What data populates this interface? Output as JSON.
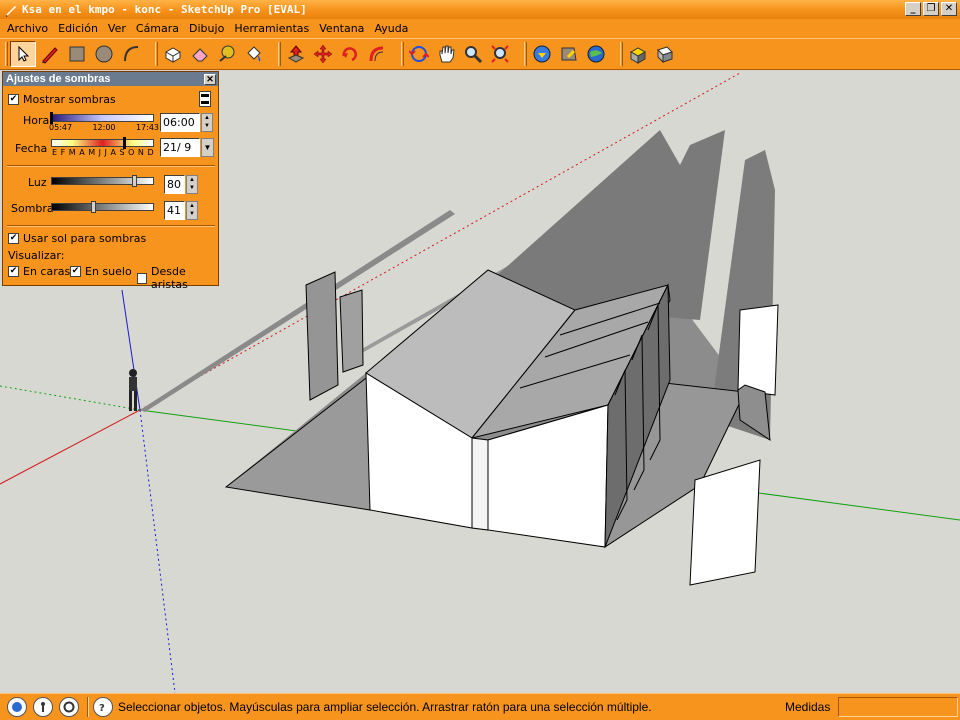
{
  "window": {
    "title": "Ksa en el kmpo - konc - SketchUp Pro [EVAL]",
    "controls": [
      "_",
      "❐",
      "✕"
    ]
  },
  "menu": [
    "Archivo",
    "Edición",
    "Ver",
    "Cámara",
    "Dibujo",
    "Herramientas",
    "Ventana",
    "Ayuda"
  ],
  "toolbar": {
    "tools": [
      "select-icon",
      "pencil-icon",
      "rectangle-icon",
      "circle-icon",
      "arc-icon",
      "make-component-icon",
      "eraser-icon",
      "tape-measure-icon",
      "paint-bucket-icon",
      "push-pull-icon",
      "move-icon",
      "rotate-icon",
      "follow-me-icon",
      "orbit-icon",
      "pan-icon",
      "zoom-icon",
      "zoom-extents-icon",
      "get-models-icon",
      "share-model-icon",
      "google-earth-icon",
      "components-icon",
      "3d-warehouse-icon"
    ]
  },
  "shadow_panel": {
    "title": "Ajustes de sombras",
    "show_shadows_label": "Mostrar sombras",
    "show_shadows_checked": true,
    "hora_label": "Hora",
    "hora_ticks": [
      "05:47",
      "12:00",
      "17:43"
    ],
    "hora_value": "06:00",
    "fecha_label": "Fecha",
    "fecha_ticks": "E F M A M J J A S O N D",
    "fecha_value": "21/ 9",
    "luz_label": "Luz",
    "luz_value": "80",
    "luz_level": 0.8,
    "sombra_label": "Sombra",
    "sombra_value": "41",
    "sombra_level": 0.41,
    "use_sun_label": "Usar sol para sombras",
    "use_sun_checked": true,
    "visualizar_label": "Visualizar:",
    "en_caras_label": "En caras",
    "en_caras_checked": true,
    "en_suelo_label": "En suelo",
    "en_suelo_checked": true,
    "desde_aristas_label": "Desde aristas",
    "desde_aristas_checked": false
  },
  "statusbar": {
    "message": "Seleccionar objetos. Mayúsculas para ampliar selección. Arrastrar ratón para una selección múltiple.",
    "measure_label": "Medidas",
    "measure_value": ""
  },
  "colors": {
    "orange": "#f7941d",
    "viewport": "#d8d8d3",
    "ground_shadow": "#8a8a8a",
    "wall": "#ffffff",
    "roof": "#b8b8b8",
    "axis_red": "#d01a1a",
    "axis_green": "#13a013",
    "axis_blue": "#1a1ad0"
  }
}
